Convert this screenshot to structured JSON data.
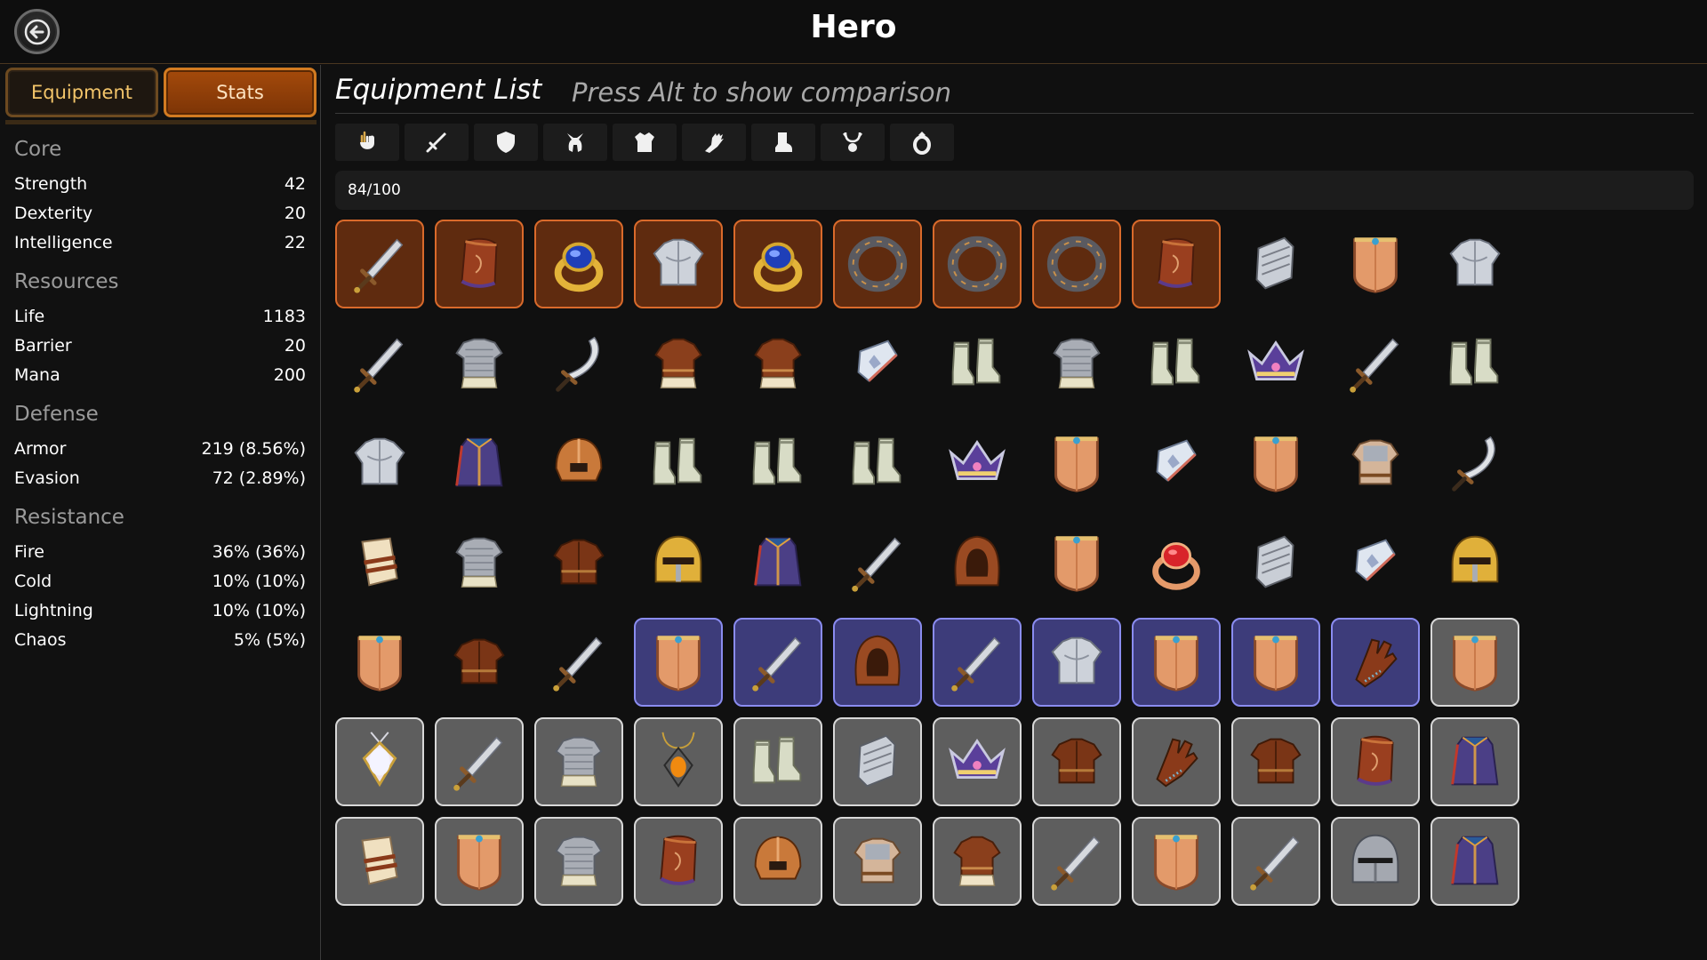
{
  "header": {
    "title": "Hero",
    "back_icon": "back-arrow-icon"
  },
  "tabs": {
    "equipment_label": "Equipment",
    "stats_label": "Stats",
    "active": "Stats"
  },
  "stats": [
    {
      "group": "Core",
      "rows": [
        {
          "label": "Strength",
          "value": "42"
        },
        {
          "label": "Dexterity",
          "value": "20"
        },
        {
          "label": "Intelligence",
          "value": "22"
        }
      ]
    },
    {
      "group": "Resources",
      "rows": [
        {
          "label": "Life",
          "value": "1183"
        },
        {
          "label": "Barrier",
          "value": "20"
        },
        {
          "label": "Mana",
          "value": "200"
        }
      ]
    },
    {
      "group": "Defense",
      "rows": [
        {
          "label": "Armor",
          "value": "219 (8.56%)"
        },
        {
          "label": "Evasion",
          "value": "72 (2.89%)"
        }
      ]
    },
    {
      "group": "Resistance",
      "rows": [
        {
          "label": "Fire",
          "value": "36% (36%)"
        },
        {
          "label": "Cold",
          "value": "10% (10%)"
        },
        {
          "label": "Lightning",
          "value": "10% (10%)"
        },
        {
          "label": "Chaos",
          "value": "5% (5%)"
        }
      ]
    }
  ],
  "main": {
    "title": "Equipment List",
    "hint": "Press Alt to show comparison",
    "filters": [
      "all-icon",
      "sword-icon",
      "shield-icon",
      "helmet-icon",
      "armor-icon",
      "gloves-icon",
      "boots-icon",
      "amulet-icon",
      "ring-icon"
    ],
    "capacity": "84/100"
  },
  "colors": {
    "orange_rarity": "#d96a2b",
    "yellow_rarity": "#dcd94e",
    "blue_rarity": "#8a8cf0",
    "grey_rarity": "#d8d8d8",
    "tab_active": "#a44a0b"
  },
  "inventory": [
    {
      "item": "sword",
      "rarity": "orange"
    },
    {
      "item": "bracer",
      "rarity": "orange"
    },
    {
      "item": "ring-blue",
      "rarity": "orange"
    },
    {
      "item": "plate-armor",
      "rarity": "orange"
    },
    {
      "item": "ring-blue",
      "rarity": "orange"
    },
    {
      "item": "iron-ring",
      "rarity": "orange"
    },
    {
      "item": "iron-ring",
      "rarity": "orange"
    },
    {
      "item": "iron-ring",
      "rarity": "orange"
    },
    {
      "item": "bracer",
      "rarity": "orange"
    },
    {
      "item": "gauntlet",
      "rarity": "yellow"
    },
    {
      "item": "shield",
      "rarity": "yellow"
    },
    {
      "item": "plate-armor",
      "rarity": "yellow"
    },
    {
      "item": "sword",
      "rarity": "yellow"
    },
    {
      "item": "chainmail",
      "rarity": "yellow"
    },
    {
      "item": "scimitar",
      "rarity": "yellow"
    },
    {
      "item": "leather-tunic",
      "rarity": "yellow"
    },
    {
      "item": "leather-tunic",
      "rarity": "yellow"
    },
    {
      "item": "vambrace",
      "rarity": "yellow"
    },
    {
      "item": "boots",
      "rarity": "yellow"
    },
    {
      "item": "chainmail",
      "rarity": "yellow"
    },
    {
      "item": "boots",
      "rarity": "yellow"
    },
    {
      "item": "crown",
      "rarity": "yellow"
    },
    {
      "item": "sword",
      "rarity": "yellow"
    },
    {
      "item": "boots",
      "rarity": "yellow"
    },
    {
      "item": "plate-armor",
      "rarity": "yellow"
    },
    {
      "item": "robe",
      "rarity": "yellow"
    },
    {
      "item": "helmet-open",
      "rarity": "yellow"
    },
    {
      "item": "boots",
      "rarity": "yellow"
    },
    {
      "item": "boots",
      "rarity": "yellow"
    },
    {
      "item": "boots",
      "rarity": "yellow"
    },
    {
      "item": "crown",
      "rarity": "yellow"
    },
    {
      "item": "shield",
      "rarity": "yellow"
    },
    {
      "item": "vambrace",
      "rarity": "yellow"
    },
    {
      "item": "shield",
      "rarity": "yellow"
    },
    {
      "item": "chest-armor",
      "rarity": "yellow"
    },
    {
      "item": "scimitar",
      "rarity": "yellow"
    },
    {
      "item": "wrap",
      "rarity": "yellow"
    },
    {
      "item": "chainmail",
      "rarity": "yellow"
    },
    {
      "item": "leather-armor",
      "rarity": "yellow"
    },
    {
      "item": "helmet-gold",
      "rarity": "yellow"
    },
    {
      "item": "robe",
      "rarity": "yellow"
    },
    {
      "item": "sword",
      "rarity": "yellow"
    },
    {
      "item": "hood",
      "rarity": "yellow"
    },
    {
      "item": "shield",
      "rarity": "yellow"
    },
    {
      "item": "ring-red",
      "rarity": "yellow"
    },
    {
      "item": "gauntlet",
      "rarity": "yellow"
    },
    {
      "item": "vambrace",
      "rarity": "yellow"
    },
    {
      "item": "helmet-gold",
      "rarity": "yellow"
    },
    {
      "item": "shield",
      "rarity": "yellow"
    },
    {
      "item": "leather-armor",
      "rarity": "yellow"
    },
    {
      "item": "sword",
      "rarity": "yellow"
    },
    {
      "item": "shield",
      "rarity": "blue"
    },
    {
      "item": "sword",
      "rarity": "blue"
    },
    {
      "item": "hood",
      "rarity": "blue"
    },
    {
      "item": "sword",
      "rarity": "blue"
    },
    {
      "item": "plate-armor",
      "rarity": "blue"
    },
    {
      "item": "shield",
      "rarity": "blue"
    },
    {
      "item": "shield",
      "rarity": "blue"
    },
    {
      "item": "glove",
      "rarity": "blue"
    },
    {
      "item": "shield",
      "rarity": "grey"
    },
    {
      "item": "amulet-pearl",
      "rarity": "grey"
    },
    {
      "item": "sword",
      "rarity": "grey"
    },
    {
      "item": "chainmail",
      "rarity": "grey"
    },
    {
      "item": "amulet-amber",
      "rarity": "grey"
    },
    {
      "item": "boots",
      "rarity": "grey"
    },
    {
      "item": "gauntlet",
      "rarity": "grey"
    },
    {
      "item": "crown",
      "rarity": "grey"
    },
    {
      "item": "leather-armor",
      "rarity": "grey"
    },
    {
      "item": "glove",
      "rarity": "grey"
    },
    {
      "item": "leather-armor",
      "rarity": "grey"
    },
    {
      "item": "bracer",
      "rarity": "grey"
    },
    {
      "item": "robe",
      "rarity": "grey"
    },
    {
      "item": "wrap",
      "rarity": "grey"
    },
    {
      "item": "shield",
      "rarity": "grey"
    },
    {
      "item": "chainmail",
      "rarity": "grey"
    },
    {
      "item": "bracer",
      "rarity": "grey"
    },
    {
      "item": "helmet-open",
      "rarity": "grey"
    },
    {
      "item": "chest-armor",
      "rarity": "grey"
    },
    {
      "item": "leather-tunic",
      "rarity": "grey"
    },
    {
      "item": "sword",
      "rarity": "grey"
    },
    {
      "item": "shield",
      "rarity": "grey"
    },
    {
      "item": "sword",
      "rarity": "grey"
    },
    {
      "item": "helmet-knight",
      "rarity": "grey"
    },
    {
      "item": "robe",
      "rarity": "grey"
    }
  ]
}
